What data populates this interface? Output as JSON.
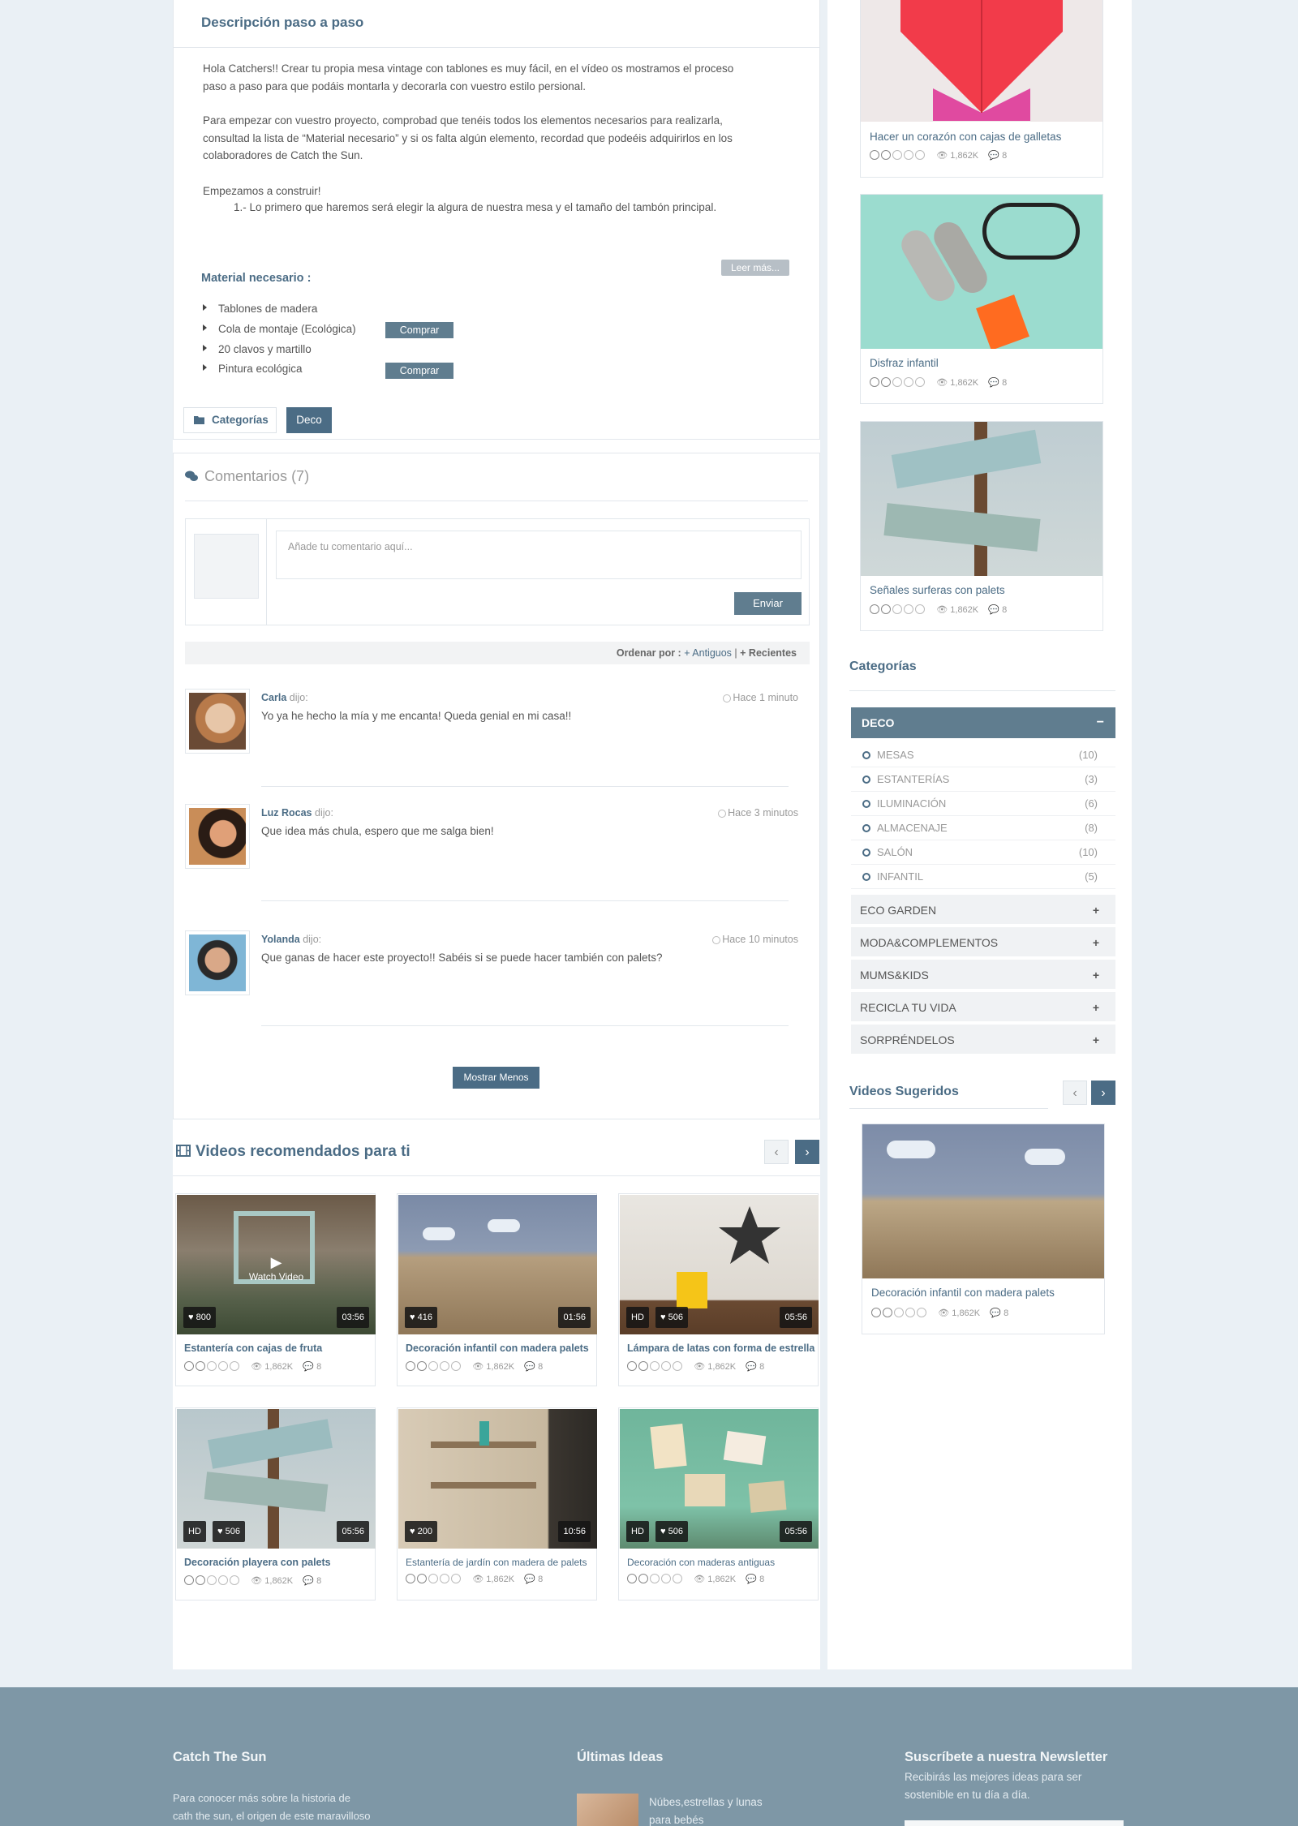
{
  "description": {
    "title": "Descripción paso a paso",
    "p1_line1": "Hola Catchers!! Crear tu propia mesa vintage con tablones es muy fácil, en el vídeo os mostramos el proceso",
    "p1_line2": "paso a paso para que podáis montarla y decorarla con vuestro estilo persional.",
    "p2_line1": "Para empezar con vuestro proyecto, comprobad que tenéis todos los elementos necesarios para realizarla,",
    "p2_line2": "consultad la lista de “Material necesario” y si os falta algún elemento, recordad que podeéis adquirirlos en los",
    "p2_line3": "colaboradores de Catch the Sun.",
    "p3": "Empezamos a construir!",
    "step1": "1.- Lo primero que haremos será elegir la algura de nuestra mesa y el tamaño del tambón principal.",
    "read_more": "Leer más...",
    "materials_title": "Material necesario :",
    "materials": [
      {
        "name": "Tablones de madera",
        "buy": ""
      },
      {
        "name": "Cola de montaje (Ecológica)",
        "buy": "Comprar"
      },
      {
        "name": "20 clavos y martillo",
        "buy": ""
      },
      {
        "name": "Pintura ecológica",
        "buy": "Comprar"
      }
    ],
    "categories_label": "Categorías",
    "category_tag": "Deco"
  },
  "comments": {
    "title": "Comentarios",
    "count": "(7)",
    "placeholder": "Añade tu comentario aquí...",
    "send": "Enviar",
    "order_label": "Ordenar por :",
    "order_old": "+ Antiguos",
    "order_sep": "|",
    "order_new": "+ Recientes",
    "list": [
      {
        "name": "Carla",
        "said": "dijo:",
        "time": "Hace 1 minuto",
        "text": "Yo ya he hecho la mía y me encanta! Queda genial en mi casa!!"
      },
      {
        "name": "Luz Rocas",
        "said": "dijo:",
        "time": "Hace 3 minutos",
        "text": "Que idea más chula, espero que me salga bien!"
      },
      {
        "name": "Yolanda",
        "said": "dijo:",
        "time": "Hace 10 minutos",
        "text": "Que ganas de hacer este proyecto!! Sabéis si se puede hacer también con palets?"
      }
    ],
    "show_less": "Mostrar Menos"
  },
  "recommended": {
    "title": "Videos recomendados para ti",
    "prev": "‹",
    "next": "›",
    "hd": "HD",
    "watch": "Watch Video",
    "videos": [
      {
        "title": "Estantería con cajas de fruta",
        "likes": "800",
        "duration": "03:56",
        "views": "1,862K",
        "comments": "8",
        "rating": 2
      },
      {
        "title": "Decoración infantil con madera palets",
        "likes": "416",
        "duration": "01:56",
        "views": "1,862K",
        "comments": "8",
        "rating": 2
      },
      {
        "title": "Lámpara de latas con forma de estrella",
        "likes": "506",
        "duration": "05:56",
        "views": "1,862K",
        "comments": "8",
        "rating": 2
      },
      {
        "title": "Decoración playera con palets",
        "likes": "506",
        "duration": "05:56",
        "views": "1,862K",
        "comments": "8",
        "rating": 2
      },
      {
        "title": "Estantería de jardín con madera de palets",
        "likes": "200",
        "duration": "10:56",
        "views": "1,862K",
        "comments": "8",
        "rating": 2
      },
      {
        "title": "Decoración con maderas antiguas",
        "likes": "506",
        "duration": "05:56",
        "views": "1,862K",
        "comments": "8",
        "rating": 2
      }
    ]
  },
  "sidebar": {
    "top_cards": [
      {
        "title": "Hacer un corazón con cajas de galletas",
        "views": "1,862K",
        "comments": "8"
      },
      {
        "title": "Disfraz infantil",
        "views": "1,862K",
        "comments": "8"
      },
      {
        "title": "Señales surferas con palets",
        "views": "1,862K",
        "comments": "8"
      }
    ],
    "categories_title": "Categorías",
    "open_category": "DECO",
    "open_symbol": "−",
    "closed_symbol": "+",
    "subcategories": [
      {
        "name": "MESAS",
        "count": "(10)"
      },
      {
        "name": "ESTANTERÍAS",
        "count": "(3)"
      },
      {
        "name": "ILUMINACIÓN",
        "count": "(6)"
      },
      {
        "name": "ALMACENAJE",
        "count": "(8)"
      },
      {
        "name": "SALÓN",
        "count": "(10)"
      },
      {
        "name": "INFANTIL",
        "count": "(5)"
      }
    ],
    "other_categories": [
      "ECO GARDEN",
      "MODA&COMPLEMENTOS",
      "MUMS&KIDS",
      "RECICLA TU VIDA",
      "SORPRÉNDELOS"
    ],
    "suggested_title": "Videos Sugeridos",
    "suggested": {
      "title": "Decoración infantil con madera palets",
      "views": "1,862K",
      "comments": "8"
    }
  },
  "footer": {
    "col1_title": "Catch The Sun",
    "col1_line1": "Para conocer más sobre la historia de",
    "col1_line2": "cath the sun, el origen de este maravilloso",
    "col2_title": "Últimas Ideas",
    "col2_item_line1": "Núbes,estrellas y lunas",
    "col2_item_line2": "para bebés",
    "col3_title": "Suscríbete a nuestra Newsletter",
    "col3_line1": "Recibirás las mejores ideas para ser",
    "col3_line2": "sostenible en tu día a día."
  },
  "colors": {
    "accent": "#4b6c85",
    "button": "#607d8f",
    "footer": "#7e97a6",
    "page_bg": "#eaf0f5"
  }
}
